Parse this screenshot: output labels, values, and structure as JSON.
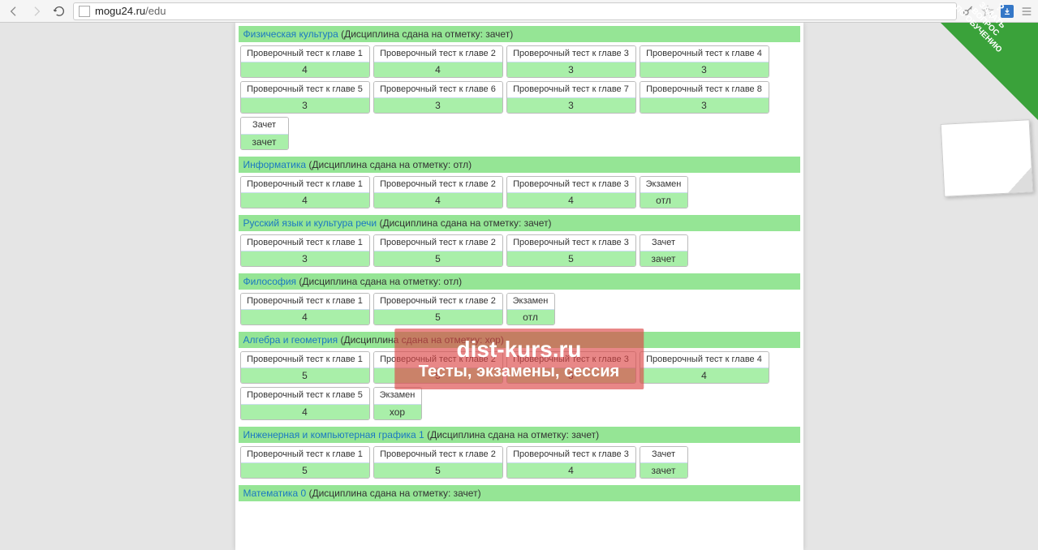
{
  "browser": {
    "url_display": "mogu24.ru",
    "url_path": "/edu"
  },
  "corner": {
    "line1": "ЗАДАТЬ",
    "line2": "ВОПРОС",
    "line3": "ПО ОБУЧЕНИЮ"
  },
  "watermark": {
    "line1": "dist-kurs.ru",
    "line2": "Тесты, экзамены, сессия"
  },
  "status_prefix": "(Дисциплина сдана на отметку: ",
  "status_suffix": ")",
  "test_name_prefix": "Проверочный тест к главе ",
  "exam_label": "Экзамен",
  "credit_label": "Зачет",
  "disciplines": [
    {
      "name": "Физическая культура",
      "status": "зачет",
      "tests": [
        {
          "n": "1",
          "g": "4"
        },
        {
          "n": "2",
          "g": "4"
        },
        {
          "n": "3",
          "g": "3"
        },
        {
          "n": "4",
          "g": "3"
        },
        {
          "n": "5",
          "g": "3"
        },
        {
          "n": "6",
          "g": "3"
        },
        {
          "n": "7",
          "g": "3"
        },
        {
          "n": "8",
          "g": "3"
        }
      ],
      "final": {
        "type": "credit",
        "grade": "зачет"
      }
    },
    {
      "name": "Информатика",
      "status": "отл",
      "tests": [
        {
          "n": "1",
          "g": "4"
        },
        {
          "n": "2",
          "g": "4"
        },
        {
          "n": "3",
          "g": "4"
        }
      ],
      "final": {
        "type": "exam",
        "grade": "отл"
      }
    },
    {
      "name": "Русский язык и культура речи",
      "status": "зачет",
      "tests": [
        {
          "n": "1",
          "g": "3"
        },
        {
          "n": "2",
          "g": "5"
        },
        {
          "n": "3",
          "g": "5"
        }
      ],
      "final": {
        "type": "credit",
        "grade": "зачет"
      }
    },
    {
      "name": "Философия",
      "status": "отл",
      "tests": [
        {
          "n": "1",
          "g": "4"
        },
        {
          "n": "2",
          "g": "5"
        }
      ],
      "final": {
        "type": "exam",
        "grade": "отл"
      }
    },
    {
      "name": "Алгебра и геометрия",
      "status": "хор",
      "tests": [
        {
          "n": "1",
          "g": "5"
        },
        {
          "n": "2",
          "g": "5"
        },
        {
          "n": "3",
          "g": "3"
        },
        {
          "n": "4",
          "g": "4"
        },
        {
          "n": "5",
          "g": "4"
        }
      ],
      "final": {
        "type": "exam",
        "grade": "хор"
      }
    },
    {
      "name": "Инженерная и компьютерная графика 1",
      "status": "зачет",
      "tests": [
        {
          "n": "1",
          "g": "5"
        },
        {
          "n": "2",
          "g": "5"
        },
        {
          "n": "3",
          "g": "4"
        }
      ],
      "final": {
        "type": "credit",
        "grade": "зачет"
      }
    },
    {
      "name": "Математика 0",
      "status": "зачет",
      "tests": [],
      "final": null
    }
  ]
}
